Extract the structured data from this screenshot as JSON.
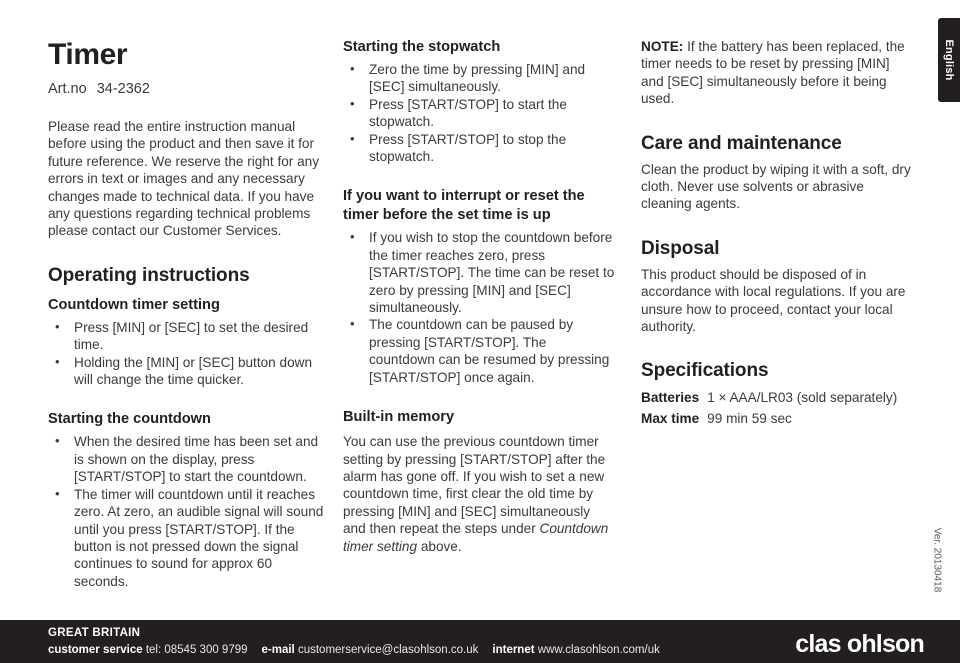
{
  "document": {
    "title": "Timer",
    "art_no_label": "Art.no",
    "art_no_value": "34-2362",
    "intro": "Please read the entire instruction manual before using the product and then save it for future reference. We reserve the right for any errors in text or images and any necessary changes made to technical data. If you have any questions regarding technical problems please contact our Customer Services."
  },
  "language_tab": {
    "label": "English"
  },
  "version": {
    "text": "Ver. 20130418"
  },
  "column1": {
    "operating_instructions_heading": "Operating instructions",
    "countdown_setting_heading": "Countdown timer setting",
    "countdown_setting_bullets": [
      "Press [MIN] or [SEC] to set the desired time.",
      "Holding the [MIN] or [SEC] button down will change the time quicker."
    ],
    "starting_countdown_heading": "Starting the countdown",
    "starting_countdown_bullets": [
      "When the desired time has been set and is shown on the display, press [START/STOP] to start the countdown.",
      "The timer will countdown until it reaches zero. At zero, an audible signal will sound until you press [START/STOP]. If the button is not pressed down the signal continues to sound for approx 60 seconds."
    ]
  },
  "column2": {
    "stopwatch_heading": "Starting the stopwatch",
    "stopwatch_bullets": [
      "Zero the time by pressing [MIN] and [SEC] simultaneously.",
      "Press [START/STOP] to start the stopwatch.",
      "Press [START/STOP] to stop the stopwatch."
    ],
    "interrupt_heading": "If you want to interrupt or reset the timer before the set time is up",
    "interrupt_bullets": [
      "If you wish to stop the countdown before the timer reaches zero, press [START/STOP]. The time can be reset to zero by pressing [MIN] and [SEC] simultaneously.",
      "The countdown can be paused by pressing [START/STOP]. The countdown can be resumed by pressing [START/STOP] once again."
    ],
    "memory_heading": "Built-in memory",
    "memory_text_before_italic": "You can use the previous countdown timer setting by pressing [START/STOP] after the alarm has gone off. If you wish to set a new countdown time, first clear the old time by pressing [MIN] and [SEC] simultaneously and then repeat the steps under ",
    "memory_italic": "Countdown timer setting",
    "memory_text_after_italic": " above."
  },
  "column3": {
    "note_label": "NOTE:",
    "note_text": " If the battery has been replaced, the timer needs to be reset by pressing [MIN] and [SEC] simultaneously before it being used.",
    "care_heading": "Care and maintenance",
    "care_text": "Clean the product by wiping it with a soft, dry cloth. Never use solvents or abrasive cleaning agents.",
    "disposal_heading": "Disposal",
    "disposal_text": "This product should be disposed of in accordance with local regulations. If you are unsure how to proceed, contact your local authority.",
    "specifications_heading": "Specifications",
    "specifications": [
      {
        "key": "Batteries",
        "value": "1 × AAA/LR03 (sold separately)"
      },
      {
        "key": "Max time",
        "value": "99 min 59 sec"
      }
    ]
  },
  "footer": {
    "country": "GREAT BRITAIN",
    "customer_service_label": "customer service",
    "tel_label": "tel:",
    "tel_value": "08545 300 9799",
    "email_label": "e-mail",
    "email_value": "customerservice@clasohlson.co.uk",
    "internet_label": "internet",
    "internet_value": "www.clasohlson.com/uk",
    "logo": "clas ohlson"
  },
  "colors": {
    "ink": "#231f20",
    "body_text": "#3c3b3b",
    "footer_background": "#231f20",
    "footer_text": "#ffffff"
  }
}
